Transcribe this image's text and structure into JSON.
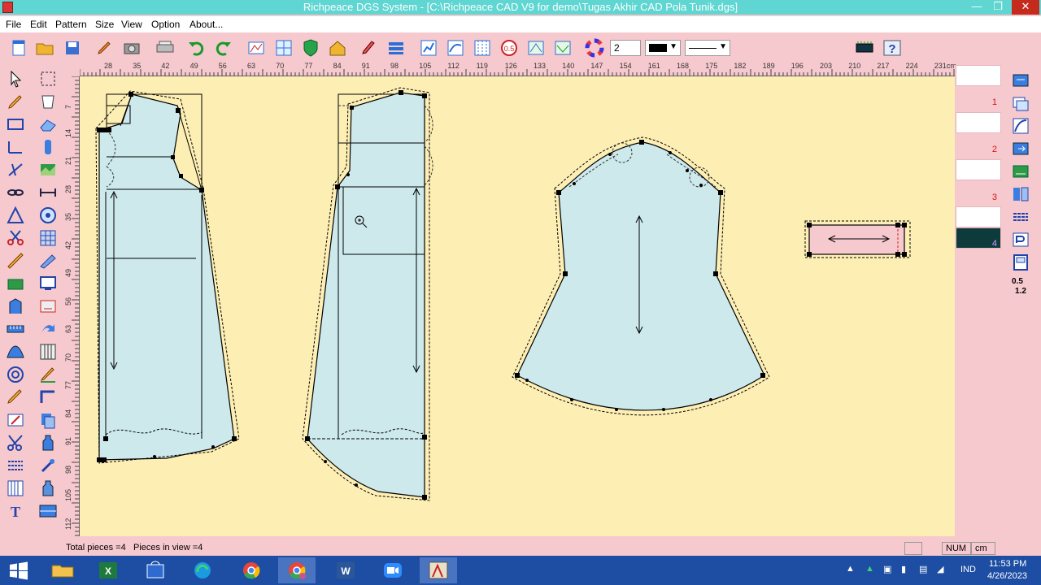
{
  "window": {
    "title": "Richpeace DGS System - [C:\\Richpeace CAD V9 for demo\\Tugas Akhir CAD Pola Tunik.dgs]",
    "minimize": "—",
    "maximize": "❐",
    "close": "✕"
  },
  "menu": [
    "File",
    "Edit",
    "Pattern",
    "Size",
    "View",
    "Option",
    "About..."
  ],
  "toolbar": {
    "number_value": "2",
    "color_value": "#000000"
  },
  "ruler": {
    "top": [
      "28",
      "35",
      "42",
      "49",
      "56",
      "63",
      "70",
      "77",
      "84",
      "91",
      "98",
      "105",
      "112",
      "119",
      "126",
      "133",
      "140",
      "147",
      "154",
      "161",
      "168",
      "175",
      "182",
      "189",
      "196",
      "203",
      "210",
      "217",
      "224",
      "231cm"
    ],
    "left": [
      "7",
      "14",
      "21",
      "28",
      "35",
      "42",
      "49",
      "56",
      "63",
      "70",
      "77",
      "84",
      "91",
      "98",
      "105",
      "112"
    ]
  },
  "pieces": {
    "labels": [
      "1",
      "2",
      "3",
      "4"
    ],
    "active_index": 3
  },
  "status": {
    "total": "Total pieces =4",
    "in_view": "Pieces in view =4",
    "num": "NUM",
    "unit": "cm"
  },
  "taskbar": {
    "lang": "IND",
    "time": "11:53 PM",
    "date": "4/26/2023"
  },
  "colors": {
    "canvas": "#fdeeb4",
    "piece_fill": "#cde9ec",
    "selected_piece": "#f6c9cf",
    "chrome": "#f6c9cf",
    "titlebar": "#5fd6d2"
  }
}
